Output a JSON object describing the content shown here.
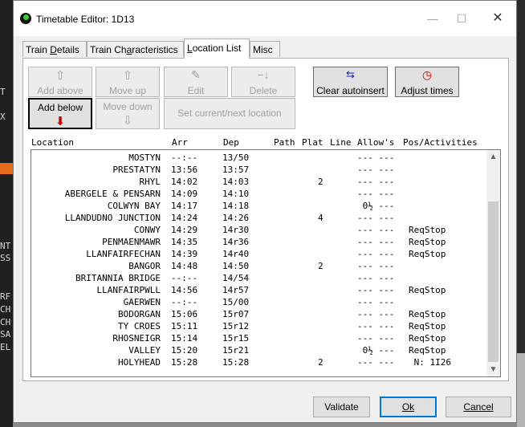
{
  "window": {
    "title": "Timetable Editor: 1D13"
  },
  "tabs": [
    {
      "label": "Train Details",
      "underline": "D",
      "pre": "Train ",
      "post": "etails",
      "active": false
    },
    {
      "label": "Train Characteristics",
      "pre": "Train Ch",
      "underline": "a",
      "post": "racteristics",
      "active": false
    },
    {
      "label": "Location List",
      "pre": "",
      "underline": "L",
      "post": "ocation List",
      "active": true
    },
    {
      "label": "Misc",
      "pre": "Misc",
      "underline": "",
      "post": "",
      "active": false
    }
  ],
  "toolbar": {
    "add_above": "Add above",
    "move_up": "Move up",
    "edit": "Edit",
    "delete": "Delete",
    "clear_autoinsert": "Clear autoinsert",
    "adjust_times": "Adjust times",
    "add_below": "Add below",
    "move_down": "Move down",
    "set_current_next": "Set current/next location"
  },
  "list": {
    "columns": [
      "Location",
      "Arr",
      "Dep",
      "Path",
      "Plat",
      "Line",
      "Allow's",
      "Pos/Activities"
    ],
    "rows": [
      {
        "location": "MOSTYN",
        "arr": "--:--",
        "dep": "13/50",
        "line": "",
        "allow": "--- ---",
        "pos": ""
      },
      {
        "location": "PRESTATYN",
        "arr": "13:56",
        "dep": "13:57",
        "line": "",
        "allow": "--- ---",
        "pos": ""
      },
      {
        "location": "RHYL",
        "arr": "14:02",
        "dep": "14:03",
        "line": "2",
        "allow": "--- ---",
        "pos": ""
      },
      {
        "location": "ABERGELE & PENSARN",
        "arr": "14:09",
        "dep": "14:10",
        "line": "",
        "allow": "--- ---",
        "pos": ""
      },
      {
        "location": "COLWYN BAY",
        "arr": "14:17",
        "dep": "14:18",
        "line": "",
        "allow": " 0½ ---",
        "pos": ""
      },
      {
        "location": "LLANDUDNO JUNCTION",
        "arr": "14:24",
        "dep": "14:26",
        "line": "4",
        "allow": "--- ---",
        "pos": ""
      },
      {
        "location": "CONWY",
        "arr": "14:29",
        "dep": "14r30",
        "line": "",
        "allow": "--- ---",
        "pos": "ReqStop"
      },
      {
        "location": "PENMAENMAWR",
        "arr": "14:35",
        "dep": "14r36",
        "line": "",
        "allow": "--- ---",
        "pos": "ReqStop"
      },
      {
        "location": "LLANFAIRFECHAN",
        "arr": "14:39",
        "dep": "14r40",
        "line": "",
        "allow": "--- ---",
        "pos": "ReqStop"
      },
      {
        "location": "BANGOR",
        "arr": "14:48",
        "dep": "14:50",
        "line": "2",
        "allow": "--- ---",
        "pos": ""
      },
      {
        "location": "BRITANNIA BRIDGE",
        "arr": "--:--",
        "dep": "14/54",
        "line": "",
        "allow": "--- ---",
        "pos": ""
      },
      {
        "location": "LLANFAIRPWLL",
        "arr": "14:56",
        "dep": "14r57",
        "line": "",
        "allow": "--- ---",
        "pos": "ReqStop"
      },
      {
        "location": "GAERWEN",
        "arr": "--:--",
        "dep": "15/00",
        "line": "",
        "allow": "--- ---",
        "pos": ""
      },
      {
        "location": "BODORGAN",
        "arr": "15:06",
        "dep": "15r07",
        "line": "",
        "allow": "--- ---",
        "pos": "ReqStop"
      },
      {
        "location": "TY CROES",
        "arr": "15:11",
        "dep": "15r12",
        "line": "",
        "allow": "--- ---",
        "pos": "ReqStop"
      },
      {
        "location": "RHOSNEIGR",
        "arr": "15:14",
        "dep": "15r15",
        "line": "",
        "allow": "--- ---",
        "pos": "ReqStop"
      },
      {
        "location": "VALLEY",
        "arr": "15:20",
        "dep": "15r21",
        "line": "",
        "allow": " 0½ ---",
        "pos": "ReqStop"
      },
      {
        "location": "HOLYHEAD",
        "arr": "15:28",
        "dep": "15:28",
        "line": "2",
        "allow": "--- ---",
        "pos": " N: 1I26"
      }
    ]
  },
  "buttons": {
    "validate": "Validate",
    "ok": "Ok",
    "cancel": "Cancel"
  },
  "background_text": [
    "T",
    "X",
    "NT",
    "SS",
    "RF",
    "CH",
    "CH",
    "SA",
    "EL"
  ],
  "colors": {
    "accent": "#0078d7",
    "add_below_arrow": "#c00000"
  }
}
